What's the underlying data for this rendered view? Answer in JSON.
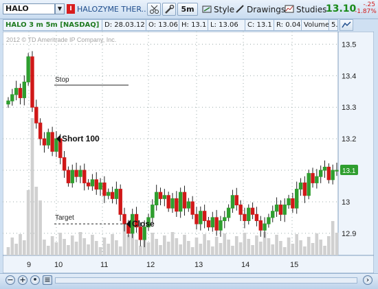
{
  "toolbar": {
    "symbol": "HALO",
    "stock_tag": "I",
    "company_name": "HALOZYME THER...",
    "period": "5m",
    "style_label": "Style",
    "drawings_label": "Drawings",
    "studies_label": "Studies",
    "last_price": "13.10",
    "net_change": "-.25",
    "pct_change": "-1.87%"
  },
  "info": {
    "title": "HALO 3 m 5m [NASDAQ]",
    "date": "D: 28.03.12",
    "open": "O: 13.06",
    "high": "H: 13.1",
    "low": "L: 13.06",
    "close": "C: 13.1",
    "range": "R: 0.04",
    "volume": "Volume",
    "extra": "5..."
  },
  "chart": {
    "watermark": "2012 © TD Ameritrade IP Company, Inc.",
    "price_ticks": [
      "13.5",
      "13.4",
      "13.3",
      "13.2",
      "13.1",
      "13",
      "12.9"
    ],
    "time_ticks": [
      "9",
      "10",
      "11",
      "12",
      "13",
      "14",
      "15"
    ],
    "current_price_badge": "13.1",
    "annotations": {
      "stop": "Stop",
      "short": "Short 100",
      "target": "Target",
      "close": "Close"
    }
  },
  "chart_data": {
    "type": "candlestick",
    "ylim": [
      12.83,
      13.54
    ],
    "x_ticks": [
      "9",
      "10",
      "11",
      "12",
      "13",
      "14",
      "15"
    ],
    "y_ticks": [
      13.5,
      13.4,
      13.3,
      13.2,
      13.1,
      13.0,
      12.9
    ],
    "annotation_levels": {
      "stop": 13.37,
      "short": 13.2,
      "target": 12.93,
      "close": 12.93
    },
    "closes": [
      13.32,
      13.34,
      13.36,
      13.33,
      13.38,
      13.46,
      13.3,
      13.25,
      13.2,
      13.18,
      13.22,
      13.16,
      13.2,
      13.14,
      13.1,
      13.06,
      13.1,
      13.08,
      13.1,
      13.06,
      13.05,
      13.07,
      13.04,
      13.06,
      13.02,
      13.03,
      13.01,
      13.04,
      12.96,
      12.93,
      12.9,
      12.96,
      12.92,
      12.88,
      12.92,
      12.95,
      12.99,
      13.03,
      13.01,
      13.02,
      12.98,
      13.01,
      12.97,
      13.03,
      12.98,
      13.0,
      12.96,
      12.93,
      12.97,
      12.94,
      12.92,
      12.95,
      12.91,
      12.94,
      12.95,
      12.98,
      13.02,
      12.99,
      12.96,
      12.94,
      12.98,
      12.96,
      12.94,
      12.91,
      12.93,
      12.95,
      12.97,
      12.99,
      12.96,
      12.99,
      13.01,
      12.98,
      13.04,
      13.06,
      13.02,
      13.09,
      13.06,
      13.08,
      13.1,
      13.11,
      13.07,
      13.1,
      13.1
    ]
  }
}
